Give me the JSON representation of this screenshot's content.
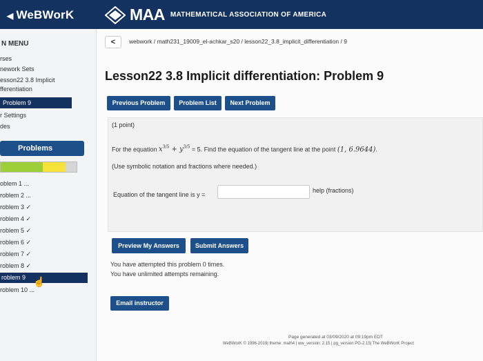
{
  "header": {
    "brand": "WeBWorK",
    "maa_logo_text": "MAA",
    "maa_subtitle": "MATHEMATICAL ASSOCIATION OF AMERICA",
    "bg_color": "#14325f"
  },
  "sidebar": {
    "menu_label": "N MENU",
    "items": [
      {
        "label": "rses"
      },
      {
        "label": "nework Sets"
      },
      {
        "label": "esson22 3.8 Implicit"
      },
      {
        "label": "fferentiation"
      }
    ],
    "active_item": "Problem 9",
    "settings": "r Settings",
    "grades": "des",
    "problems_button": "Problems",
    "progress": {
      "green_fraction": 0.55,
      "yellow_fraction": 0.3
    },
    "problem_list": [
      {
        "label": "oblem 1 ..."
      },
      {
        "label": "roblem 2 ..."
      },
      {
        "label": "roblem 3 ✓"
      },
      {
        "label": "roblem 4 ✓"
      },
      {
        "label": "roblem 5 ✓"
      },
      {
        "label": "roblem 6 ✓"
      },
      {
        "label": "roblem 7 ✓"
      },
      {
        "label": "roblem 8 ✓"
      },
      {
        "label": "roblem 9"
      },
      {
        "label": "roblem 10 ..."
      }
    ]
  },
  "main": {
    "breadcrumb": "webwork / math231_19009_el-achkar_s20 / lesson22_3.8_implicit_differentiation / 9",
    "title": "Lesson22 3.8 Implicit differentiation: Problem 9",
    "nav": {
      "previous": "Previous Problem",
      "list": "Problem List",
      "next": "Next Problem"
    },
    "points": "(1 point)",
    "question": {
      "prefix": "For the equation ",
      "x": "x",
      "x_exp": "3/5",
      "plus": " + ",
      "y": "y",
      "y_exp": "3/5",
      "equals": " = 5. Find the equation of the tangent line at the point ",
      "point": "(1, 6.9644)",
      "suffix": "."
    },
    "hint": "(Use symbolic notation and fractions where needed.)",
    "answer_label": "Equation of the tangent line is y =",
    "answer_value": "",
    "help": "help (fractions)",
    "preview_button": "Preview My Answers",
    "submit_button": "Submit Answers",
    "attempts_1": "You have attempted this problem 0 times.",
    "attempts_2": "You have unlimited attempts remaining.",
    "email_button": "Email instructor"
  },
  "footer": {
    "generated": "Page generated at 03/09/2020 at 09:19pm EDT",
    "credits": "WeBWorK © 1996-2019| theme: math4 | ww_version: 2.15 | pg_version PG-2.15| The WeBWorK Project"
  }
}
